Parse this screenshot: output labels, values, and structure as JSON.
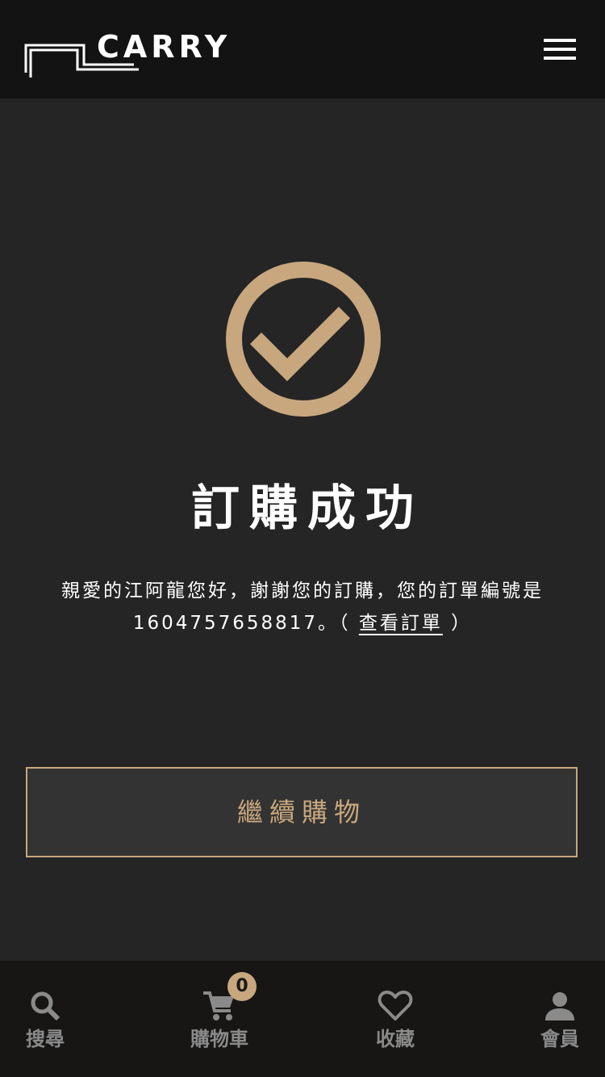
{
  "header": {
    "brand": "CARRY",
    "menu_icon": "hamburger-menu-icon"
  },
  "main": {
    "status_icon": "check-circle-icon",
    "title": "訂購成功",
    "message_prefix": "親愛的江阿龍您好，謝謝您的訂購，您的訂單編號是",
    "order_number": "1604757658817",
    "message_mid": "。（ ",
    "view_order_link": "查看訂單",
    "message_suffix": " ）",
    "continue_button": "繼續購物"
  },
  "tabbar": {
    "items": [
      {
        "label": "搜尋",
        "icon": "search-icon"
      },
      {
        "label": "購物車",
        "icon": "cart-icon",
        "badge": "0"
      },
      {
        "label": "收藏",
        "icon": "heart-icon"
      },
      {
        "label": "會員",
        "icon": "person-icon"
      }
    ]
  },
  "colors": {
    "accent": "#c8a77e",
    "header_bg": "#131313",
    "page_bg": "#252525",
    "tabbar_bg": "#171615",
    "tab_label": "#8a8a8a"
  }
}
